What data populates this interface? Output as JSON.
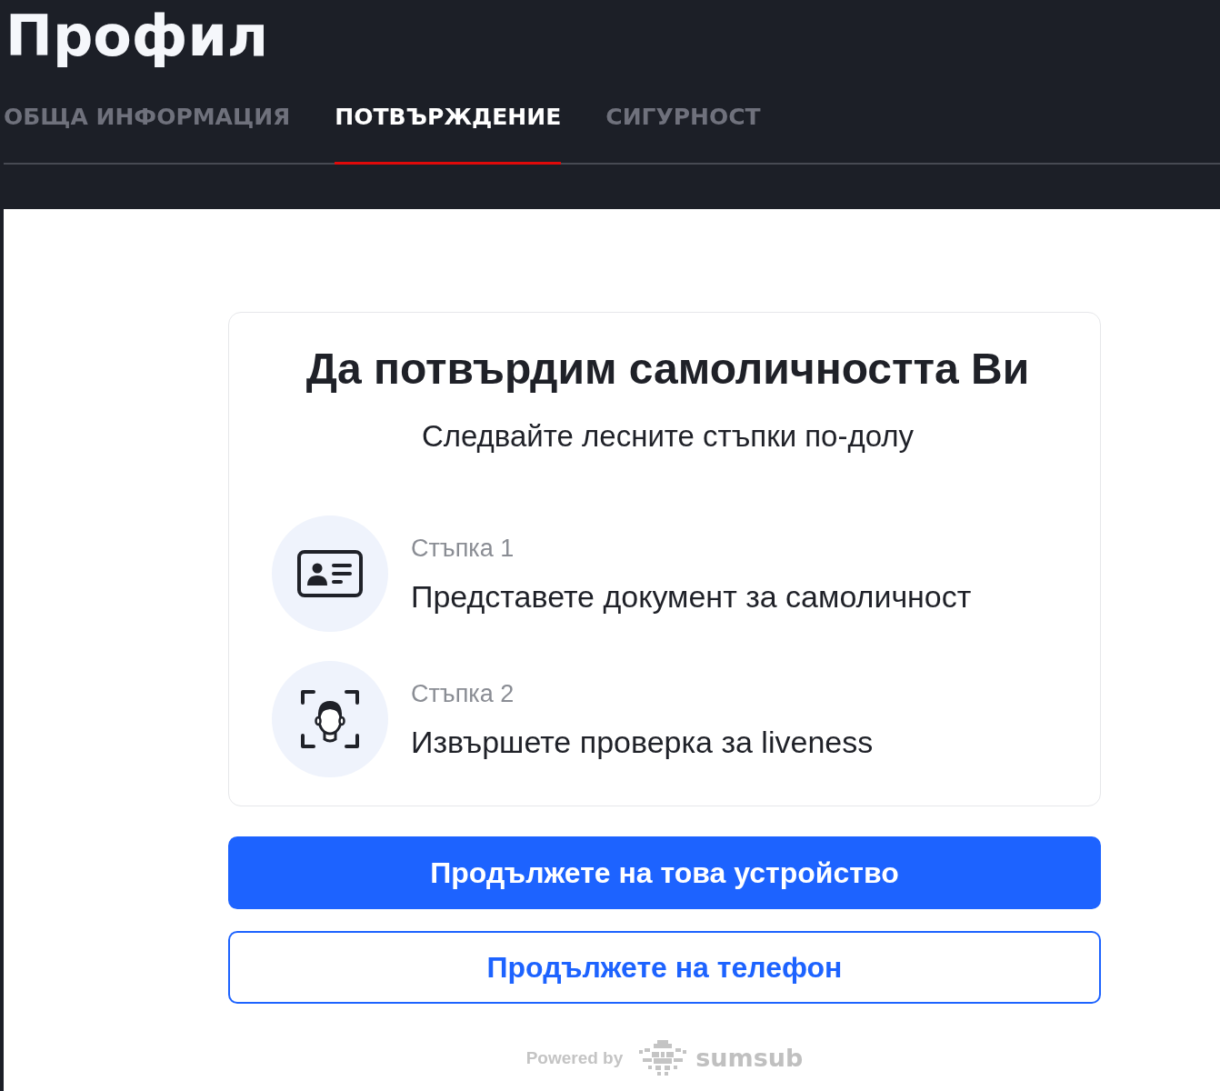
{
  "page": {
    "title": "Профил"
  },
  "tabs": [
    {
      "label": "ОБЩА ИНФОРМАЦИЯ",
      "selected": false
    },
    {
      "label": "ПОТВЪРЖДЕНИЕ",
      "selected": true
    },
    {
      "label": "СИГУРНОСТ",
      "selected": false
    }
  ],
  "verification": {
    "title": "Да потвърдим самоличността Ви",
    "subtitle": "Следвайте лесните стъпки по-долу",
    "steps": [
      {
        "kind": "document",
        "label": "Стъпка 1",
        "description": "Представете документ за самоличност"
      },
      {
        "kind": "liveness",
        "label": "Стъпка 2",
        "description": "Извършете проверка за liveness"
      }
    ]
  },
  "buttons": [
    {
      "kind": "primary",
      "label": "Продължете на това устройство"
    },
    {
      "kind": "secondary",
      "label": "Продължете на телефон"
    }
  ],
  "footer": {
    "powered_by": "Powered by",
    "brand": "sumsub"
  }
}
